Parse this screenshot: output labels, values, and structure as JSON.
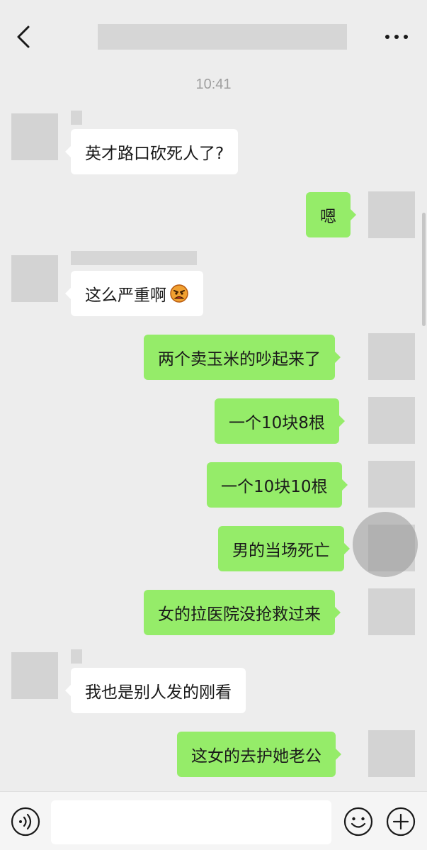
{
  "header": {
    "time": "10:41"
  },
  "messages": [
    {
      "side": "in",
      "text": "英才路口砍死人了?"
    },
    {
      "side": "out",
      "text": "嗯"
    },
    {
      "side": "in",
      "text": "这么严重啊",
      "emoji": "angry-face-emoji"
    },
    {
      "side": "out",
      "text": "两个卖玉米的吵起来了"
    },
    {
      "side": "out",
      "text": "一个10块8根"
    },
    {
      "side": "out",
      "text": "一个10块10根"
    },
    {
      "side": "out",
      "text": "男的当场死亡"
    },
    {
      "side": "out",
      "text": "女的拉医院没抢救过来"
    },
    {
      "side": "in",
      "text": "我也是别人发的刚看"
    },
    {
      "side": "out",
      "text": "这女的去护她老公"
    }
  ],
  "icons": {
    "back": "chevron-left-icon",
    "more": "more-dots-icon",
    "voice": "voice-icon",
    "emoji": "smiley-icon",
    "plus": "plus-icon"
  },
  "colors": {
    "background": "#ededed",
    "incoming_bubble": "#ffffff",
    "outgoing_bubble": "#95ec69",
    "placeholder": "#d3d3d3"
  },
  "input": {
    "value": "",
    "placeholder": ""
  }
}
